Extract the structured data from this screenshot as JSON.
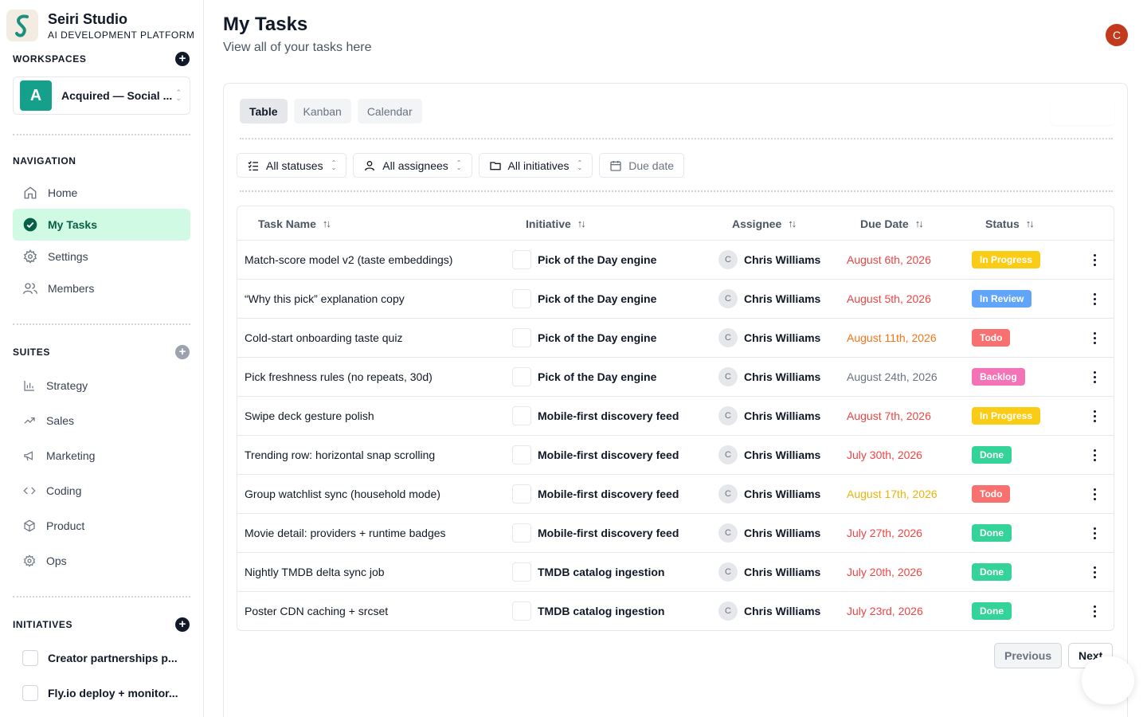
{
  "brand": {
    "name": "Seiri Studio",
    "subtitle": "AI DEVELOPMENT PLATFORM"
  },
  "workspaces": {
    "title": "WORKSPACES",
    "current": {
      "initial": "A",
      "name": "Acquired — Social ..."
    }
  },
  "navigation": {
    "title": "NAVIGATION",
    "items": [
      {
        "label": "Home",
        "icon": "home-icon"
      },
      {
        "label": "My Tasks",
        "icon": "check-circle-icon",
        "active": true
      },
      {
        "label": "Settings",
        "icon": "gear-icon"
      },
      {
        "label": "Members",
        "icon": "users-icon"
      }
    ]
  },
  "suites": {
    "title": "SUITES",
    "items": [
      {
        "label": "Strategy",
        "icon": "bar-chart-icon"
      },
      {
        "label": "Sales",
        "icon": "trending-up-icon"
      },
      {
        "label": "Marketing",
        "icon": "megaphone-icon"
      },
      {
        "label": "Coding",
        "icon": "code-icon"
      },
      {
        "label": "Product",
        "icon": "box-icon"
      },
      {
        "label": "Ops",
        "icon": "gear-icon"
      }
    ]
  },
  "initiatives": {
    "title": "INITIATIVES",
    "items": [
      {
        "label": "Creator partnerships p..."
      },
      {
        "label": "Fly.io deploy + monitor..."
      }
    ]
  },
  "header": {
    "title": "My Tasks",
    "subtitle": "View all of your tasks here",
    "user_initial": "C"
  },
  "view_tabs": [
    {
      "label": "Table",
      "active": true
    },
    {
      "label": "Kanban"
    },
    {
      "label": "Calendar"
    }
  ],
  "filters": {
    "statuses": "All statuses",
    "assignees": "All assignees",
    "initiatives": "All initiatives",
    "due_date": "Due date"
  },
  "table": {
    "columns": {
      "task": "Task Name",
      "initiative": "Initiative",
      "assignee": "Assignee",
      "due": "Due Date",
      "status": "Status"
    },
    "rows": [
      {
        "task": "Match-score model v2 (taste embeddings)",
        "initiative": "Pick of the Day engine",
        "assignee_initial": "C",
        "assignee": "Chris Williams",
        "due": "August 6th, 2026",
        "due_color": "#ef4444",
        "status": "In Progress",
        "status_color": "#facc15"
      },
      {
        "task": "“Why this pick” explanation copy",
        "initiative": "Pick of the Day engine",
        "assignee_initial": "C",
        "assignee": "Chris Williams",
        "due": "August 5th, 2026",
        "due_color": "#ef4444",
        "status": "In Review",
        "status_color": "#60a5fa"
      },
      {
        "task": "Cold-start onboarding taste quiz",
        "initiative": "Pick of the Day engine",
        "assignee_initial": "C",
        "assignee": "Chris Williams",
        "due": "August 11th, 2026",
        "due_color": "#f97316",
        "status": "Todo",
        "status_color": "#f87171"
      },
      {
        "task": "Pick freshness rules (no repeats, 30d)",
        "initiative": "Pick of the Day engine",
        "assignee_initial": "C",
        "assignee": "Chris Williams",
        "due": "August 24th, 2026",
        "due_color": "#6b7280",
        "status": "Backlog",
        "status_color": "#f472b6"
      },
      {
        "task": "Swipe deck gesture polish",
        "initiative": "Mobile-first discovery feed",
        "assignee_initial": "C",
        "assignee": "Chris Williams",
        "due": "August 7th, 2026",
        "due_color": "#ef4444",
        "status": "In Progress",
        "status_color": "#facc15"
      },
      {
        "task": "Trending row: horizontal snap scrolling",
        "initiative": "Mobile-first discovery feed",
        "assignee_initial": "C",
        "assignee": "Chris Williams",
        "due": "July 30th, 2026",
        "due_color": "#ef4444",
        "status": "Done",
        "status_color": "#34d399"
      },
      {
        "task": "Group watchlist sync (household mode)",
        "initiative": "Mobile-first discovery feed",
        "assignee_initial": "C",
        "assignee": "Chris Williams",
        "due": "August 17th, 2026",
        "due_color": "#eab308",
        "status": "Todo",
        "status_color": "#f87171"
      },
      {
        "task": "Movie detail: providers + runtime badges",
        "initiative": "Mobile-first discovery feed",
        "assignee_initial": "C",
        "assignee": "Chris Williams",
        "due": "July 27th, 2026",
        "due_color": "#ef4444",
        "status": "Done",
        "status_color": "#34d399"
      },
      {
        "task": "Nightly TMDB delta sync job",
        "initiative": "TMDB catalog ingestion",
        "assignee_initial": "C",
        "assignee": "Chris Williams",
        "due": "July 20th, 2026",
        "due_color": "#ef4444",
        "status": "Done",
        "status_color": "#34d399"
      },
      {
        "task": "Poster CDN caching + srcset",
        "initiative": "TMDB catalog ingestion",
        "assignee_initial": "C",
        "assignee": "Chris Williams",
        "due": "July 23rd, 2026",
        "due_color": "#ef4444",
        "status": "Done",
        "status_color": "#34d399"
      }
    ]
  },
  "pagination": {
    "previous": "Previous",
    "next": "Next"
  }
}
